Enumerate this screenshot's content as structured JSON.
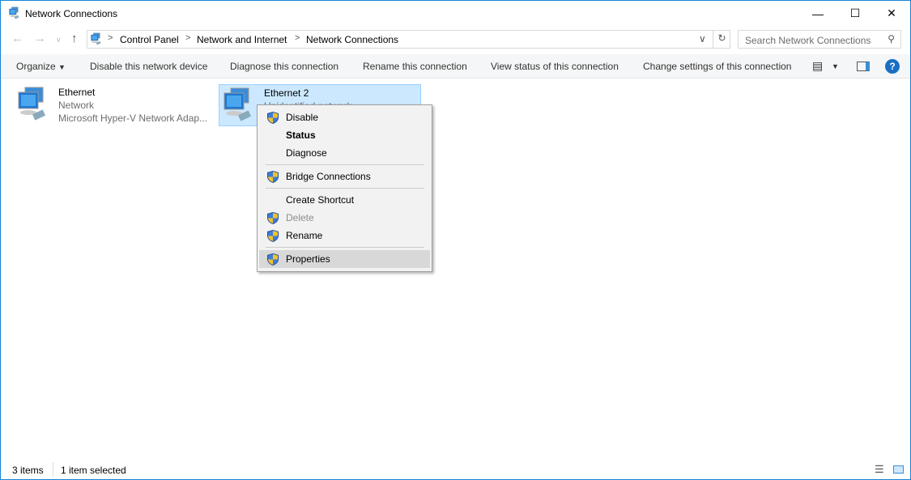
{
  "window": {
    "title": "Network Connections",
    "controls": [
      "minimize",
      "maximize",
      "close"
    ]
  },
  "nav": {
    "breadcrumb": [
      "Control Panel",
      "Network and Internet",
      "Network Connections"
    ],
    "search_placeholder": "Search Network Connections"
  },
  "commands": {
    "organize": "Organize",
    "items": [
      "Disable this network device",
      "Diagnose this connection",
      "Rename this connection",
      "View status of this connection",
      "Change settings of this connection"
    ]
  },
  "connections": [
    {
      "name": "Ethernet",
      "status": "Network",
      "adapter": "Microsoft Hyper-V Network Adap..."
    },
    {
      "name": "Ethernet 2",
      "status": "Unidentified network",
      "selected": true
    }
  ],
  "context_menu": {
    "items": [
      {
        "label": "Disable",
        "shield": true
      },
      {
        "label": "Status",
        "bold": true
      },
      {
        "label": "Diagnose"
      },
      {
        "label": "Bridge Connections",
        "shield": true
      },
      {
        "label": "Create Shortcut"
      },
      {
        "label": "Delete",
        "shield": true,
        "disabled": true
      },
      {
        "label": "Rename",
        "shield": true
      },
      {
        "label": "Properties",
        "shield": true,
        "highlighted": true
      }
    ]
  },
  "statusbar": {
    "count": "3 items",
    "selected": "1 item selected"
  },
  "colors": {
    "accent": "#1883d7",
    "selection": "#cce8ff",
    "help": "#1a6fc4"
  }
}
